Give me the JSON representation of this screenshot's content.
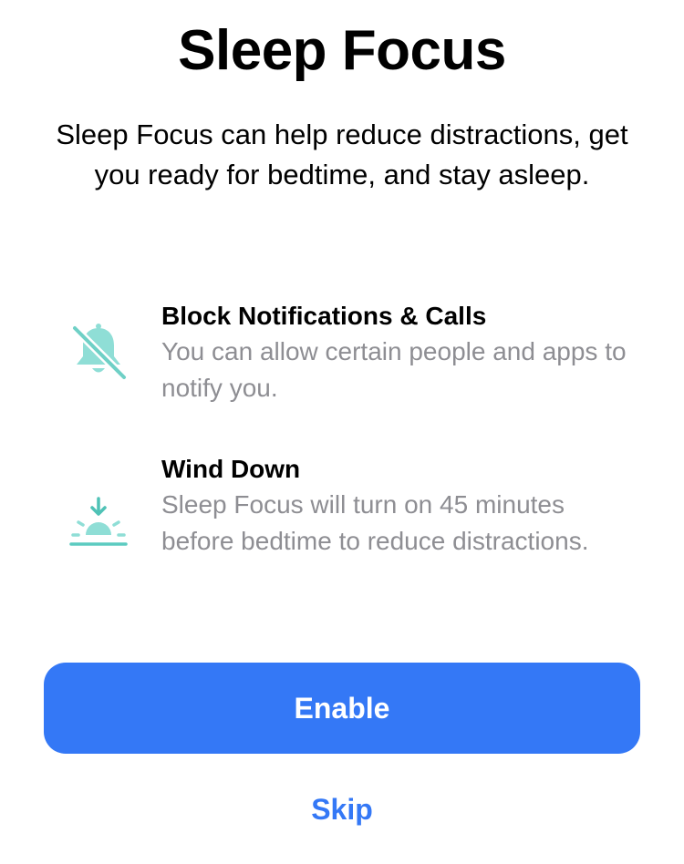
{
  "header": {
    "title": "Sleep Focus",
    "subtitle": "Sleep Focus can help reduce distractions, get you ready for bedtime, and stay asleep."
  },
  "features": [
    {
      "icon": "bell-slash-icon",
      "title": "Block Notifications & Calls",
      "description": "You can allow certain people and apps to notify you."
    },
    {
      "icon": "sunset-icon",
      "title": "Wind Down",
      "description": "Sleep Focus will turn on 45 minutes before bedtime to reduce distractions."
    }
  ],
  "actions": {
    "enable_label": "Enable",
    "skip_label": "Skip"
  },
  "colors": {
    "accent": "#3478f6",
    "icon_teal": "#7fd8d0",
    "icon_teal_dark": "#5ccbc0",
    "secondary_text": "#8e8e93"
  }
}
